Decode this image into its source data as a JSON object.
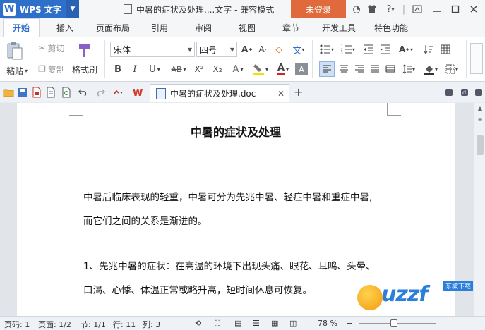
{
  "titlebar": {
    "app_name": "WPS 文字",
    "logo_letter": "W",
    "doc_title": "中暑的症状及处理....文字 - 兼容模式",
    "login_label": "未登录",
    "help_label": "?"
  },
  "menu": {
    "tabs": [
      "开始",
      "插入",
      "页面布局",
      "引用",
      "审阅",
      "视图",
      "章节",
      "开发工具",
      "特色功能"
    ],
    "active": "开始"
  },
  "ribbon": {
    "paste_label": "粘贴",
    "cut_label": "剪切",
    "copy_label": "复制",
    "format_painter_label": "格式刷",
    "font_name": "宋体",
    "font_size": "四号",
    "bold": "B",
    "italic": "I",
    "underline": "U",
    "strike": "AB",
    "superscript": "X²",
    "subscript": "X₂",
    "font_color_letter": "A",
    "wen": "文"
  },
  "doc_tab": {
    "name": "中暑的症状及处理.doc"
  },
  "document": {
    "title": "中暑的症状及处理",
    "lines": [
      "中暑后临床表现的轻重，中暑可分为先兆中暑、轻症中暑和重症中暑,",
      "而它们之间的关系是渐进的。",
      "1、先兆中暑的症状：在高温的环境下出现头痛、眼花、耳鸣、头晕、",
      "口渴、心悸、体温正常或略升高，短时间休息可恢复。"
    ]
  },
  "status": {
    "page_code": "页码: 1",
    "page": "页面: 1/2",
    "section": "节: 1/1",
    "row": "行: 11",
    "col": "列: 3",
    "zoom": "78 %"
  },
  "watermark": {
    "text": "uzzf",
    "sub": "东坡下载"
  },
  "colors": {
    "accent": "#2e6fc9",
    "login": "#e06a3b"
  }
}
